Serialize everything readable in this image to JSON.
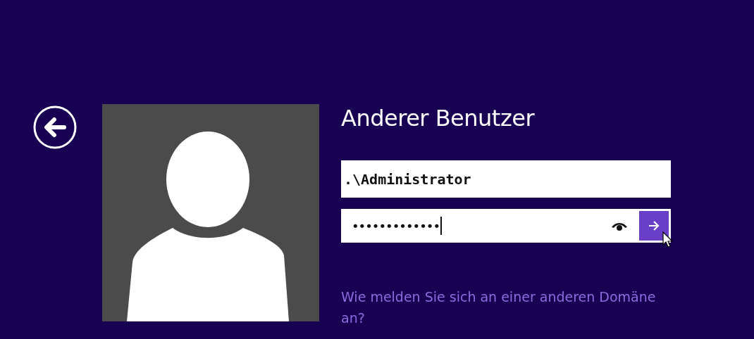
{
  "title": "Anderer Benutzer",
  "username": {
    "value": ".\\Administrator"
  },
  "password": {
    "value": "•••••••••••••",
    "focused": true
  },
  "link": "Wie melden Sie sich an einer anderen Domäne an?"
}
